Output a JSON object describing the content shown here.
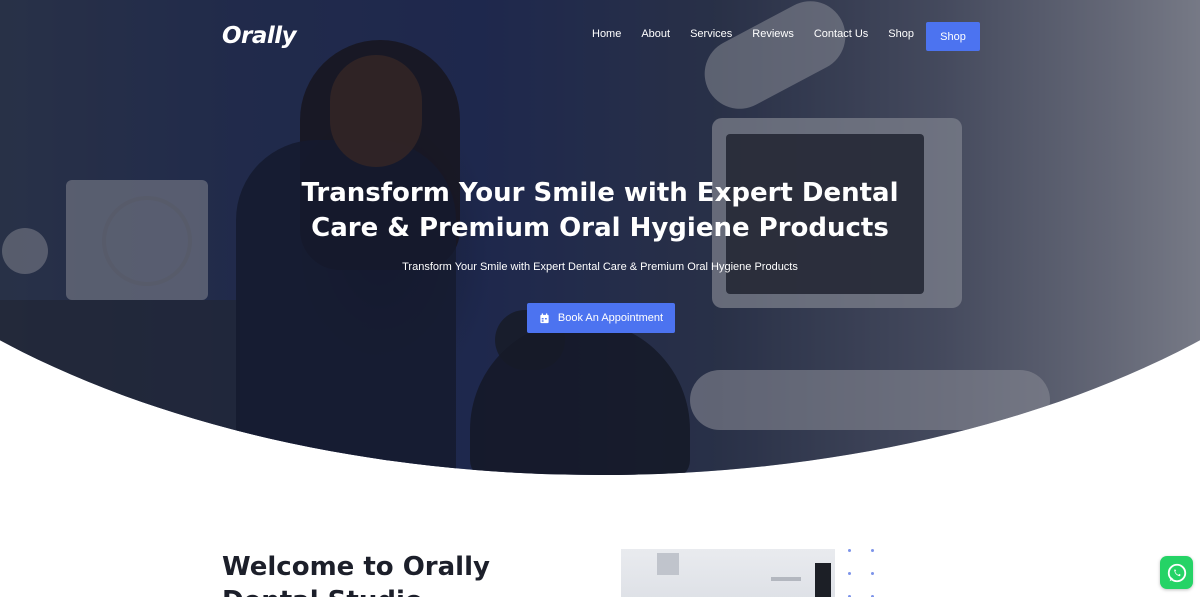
{
  "brand": {
    "logo_text": "Orally"
  },
  "nav": {
    "links": [
      "Home",
      "About",
      "Services",
      "Reviews",
      "Contact Us",
      "Shop"
    ],
    "cta_label": "Shop"
  },
  "hero": {
    "title": "Transform Your Smile with Expert Dental Care & Premium Oral Hygiene Products",
    "subtitle": "Transform Your Smile with Expert Dental Care & Premium Oral Hygiene Products",
    "button_label": "Book An Appointment",
    "button_icon": "calendar-icon"
  },
  "welcome": {
    "heading": "Welcome to Orally Dental Studio"
  },
  "floating": {
    "icon": "whatsapp-icon"
  },
  "colors": {
    "accent": "#4c73f0",
    "whatsapp": "#25d366",
    "heading": "#1c1f2a"
  }
}
